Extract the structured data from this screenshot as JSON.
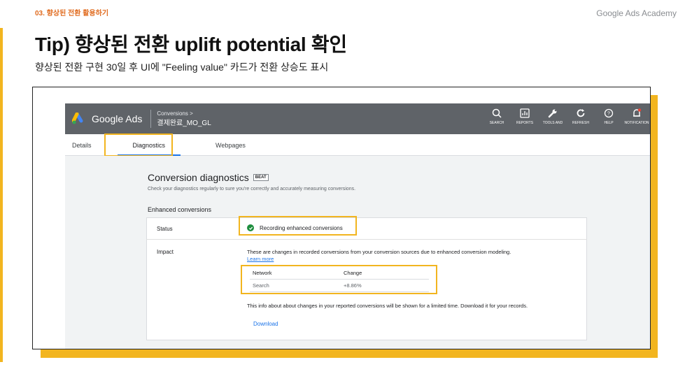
{
  "slide": {
    "section_label": "03. 향상된 전환 활용하기",
    "brand": "Google Ads Academy",
    "title": "Tip) 향상된 전환 uplift potential 확인",
    "subtitle": "향상된 전환 구현 30일 후 UI에 \"Feeling value\" 카드가 전환 상승도 표시",
    "accent_color": "#f2b51f"
  },
  "app_header": {
    "product_name": "Google Ads",
    "breadcrumb_parent": "Conversions  >",
    "breadcrumb_current": "결제완료_MO_GL",
    "actions": [
      {
        "label": "SEARCH",
        "icon": "search-icon"
      },
      {
        "label": "REPORTS",
        "icon": "reports-icon"
      },
      {
        "label": "TOOLS AND",
        "icon": "wrench-icon"
      },
      {
        "label": "REFRESH",
        "icon": "refresh-icon"
      },
      {
        "label": "HELP",
        "icon": "help-icon"
      },
      {
        "label": "NOTIFICATION",
        "icon": "bell-icon"
      }
    ]
  },
  "tabs": [
    {
      "label": "Details",
      "active": false
    },
    {
      "label": "Diagnostics",
      "active": true
    },
    {
      "label": "Webpages",
      "active": false
    }
  ],
  "diagnostics": {
    "title": "Conversion diagnostics",
    "badge": "BEAT",
    "description": "Check your diagnostics regularly to sure you're correctly and accurately measuring conversions.",
    "section_title": "Enhanced conversions",
    "status_label": "Status",
    "status_value": "Recording enhanced conversions",
    "impact_label": "Impact",
    "impact_text": "These are changes in recorded conversions from your conversion sources due to enhanced conversion modeling.",
    "learn_more": "Learn more",
    "table": {
      "headers": [
        "Network",
        "Change"
      ],
      "rows": [
        [
          "Search",
          "+8.86%"
        ]
      ]
    },
    "info_text": "This info about about changes in your reported conversions will be shown for a limited time. Download it for your records.",
    "download": "Download"
  }
}
